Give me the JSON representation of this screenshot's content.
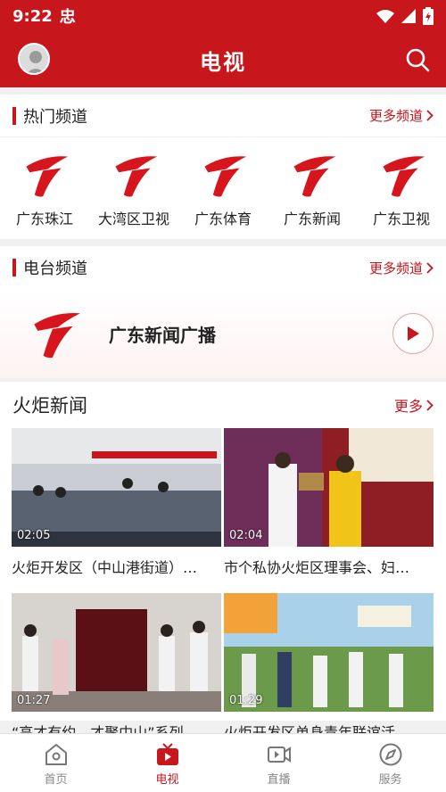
{
  "status_bar": {
    "time": "9:22",
    "notif_glyph": "忠"
  },
  "header": {
    "title": "电视"
  },
  "hot_channels": {
    "title": "热门频道",
    "more": "更多频道",
    "items": [
      {
        "name": "广东珠江"
      },
      {
        "name": "大湾区卫视"
      },
      {
        "name": "广东体育"
      },
      {
        "name": "广东新闻"
      },
      {
        "name": "广东卫视"
      }
    ]
  },
  "radio_channels": {
    "title": "电台频道",
    "more": "更多频道",
    "item": {
      "name": "广东新闻广播"
    }
  },
  "news": {
    "title": "火炬新闻",
    "more": "更多",
    "items": [
      {
        "duration": "02:05",
        "caption": "火炬开发区（中山港街道）…"
      },
      {
        "duration": "02:04",
        "caption": "市个私协火炬区理事会、妇…"
      },
      {
        "duration": "01:27",
        "caption": "“高才有约，才聚中山”系列…"
      },
      {
        "duration": "01:29",
        "caption": "火炬开发区单身青年联谊活…"
      }
    ]
  },
  "tabs": [
    {
      "label": "首页",
      "icon": "home-icon"
    },
    {
      "label": "电视",
      "icon": "tv-icon",
      "active": true
    },
    {
      "label": "直播",
      "icon": "live-icon"
    },
    {
      "label": "服务",
      "icon": "compass-icon"
    }
  ],
  "colors": {
    "brand": "#c8161d",
    "background": "#f0f0f0"
  }
}
